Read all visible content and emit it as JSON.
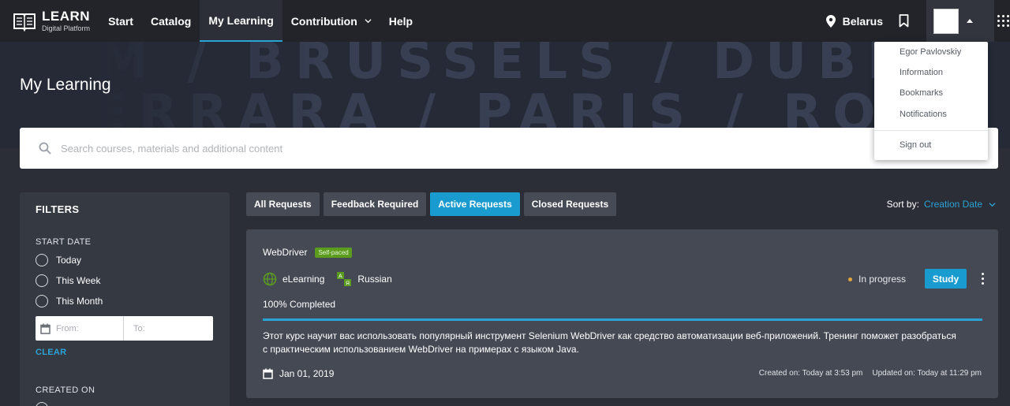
{
  "header": {
    "logo_title": "LEARN",
    "logo_subtitle": "Digital Platform",
    "nav": [
      {
        "label": "Start"
      },
      {
        "label": "Catalog"
      },
      {
        "label": "My Learning",
        "active": true
      },
      {
        "label": "Contribution",
        "has_dropdown": true
      },
      {
        "label": "Help"
      }
    ],
    "location": "Belarus",
    "icons": [
      "book-logo-icon",
      "location-pin-icon",
      "bookmark-icon",
      "avatar",
      "caret-up-icon",
      "apps-grid-icon"
    ]
  },
  "hero": {
    "title": "My Learning",
    "background_text_row1": "AM / BRUSSELS / DUBLIN / POTSDAM",
    "background_text_row2": "FERRARA / PARIS / ROME / OSLO / WIEN"
  },
  "search": {
    "placeholder": "Search courses, materials and additional content"
  },
  "filters": {
    "title": "FILTERS",
    "start_date": {
      "title": "START DATE",
      "options": [
        "Today",
        "This Week",
        "This Month"
      ],
      "from_placeholder": "From:",
      "to_placeholder": "To:",
      "clear_label": "CLEAR"
    },
    "created_on": {
      "title": "CREATED ON"
    }
  },
  "tabs": [
    {
      "label": "All Requests",
      "active": false
    },
    {
      "label": "Feedback Required",
      "active": false
    },
    {
      "label": "Active Requests",
      "active": true
    },
    {
      "label": "Closed Requests",
      "active": false
    }
  ],
  "sort": {
    "label": "Sort by:",
    "value": "Creation Date"
  },
  "card": {
    "title": "WebDriver",
    "badge": "Self-paced",
    "type": "eLearning",
    "language": "Russian",
    "status": "In progress",
    "study_label": "Study",
    "completed": "100% Completed",
    "progress_fraction": 1.0,
    "description": "Этот курс научит вас использовать популярный инструмент Selenium WebDriver как средство автоматизации веб-приложений. Тренинг поможет разобраться с практическим использованием WebDriver на примерах с языком Java.",
    "date": "Jan 01, 2019",
    "created": "Created on: Today at 3:53 pm",
    "updated": "Updated on: Today at 11:29 pm"
  },
  "user_menu": {
    "items": [
      "Egor Pavlovskiy",
      "Information",
      "Bookmarks",
      "Notifications",
      "Sign out"
    ]
  },
  "colors": {
    "accent": "#2aa4d6",
    "nav_bg": "#222429",
    "page_bg": "#2b2e36",
    "card_bg": "#454954",
    "badge_green": "#5b9c1f",
    "status_dot": "#e2a73a"
  }
}
